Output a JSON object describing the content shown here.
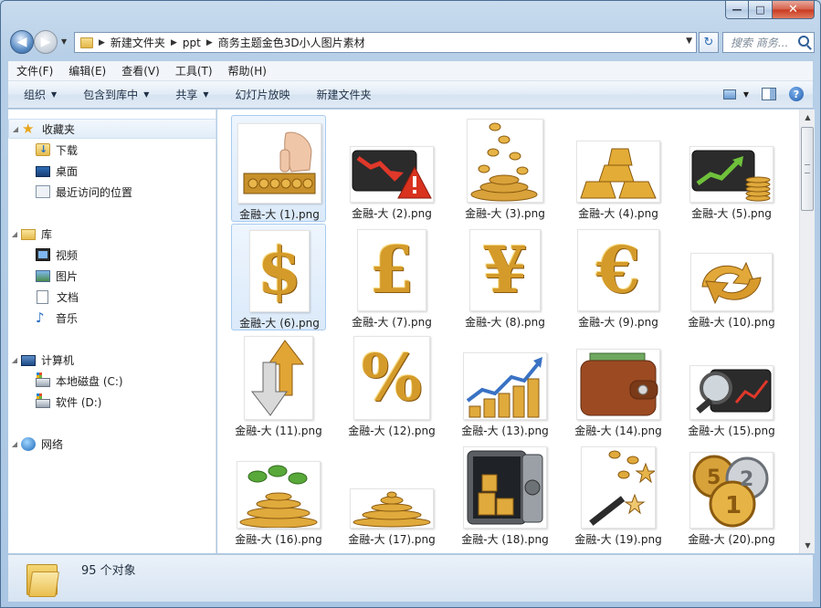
{
  "window": {
    "caption": {
      "minimize": "—",
      "maximize": "□",
      "close": "✕"
    }
  },
  "address": {
    "crumbs": [
      "新建文件夹",
      "ppt",
      "商务主题金色3D小人图片素材"
    ],
    "search_placeholder": "搜索 商务...",
    "back_glyph": "◀",
    "forward_glyph": "▶",
    "refresh_glyph": "↻"
  },
  "menubar": [
    "文件(F)",
    "编辑(E)",
    "查看(V)",
    "工具(T)",
    "帮助(H)"
  ],
  "commandbar": {
    "organize": "组织",
    "include_in_library": "包含到库中",
    "share": "共享",
    "slideshow": "幻灯片放映",
    "new_folder": "新建文件夹",
    "help_glyph": "?"
  },
  "navpane": {
    "favorites": "收藏夹",
    "downloads": "下载",
    "desktop": "桌面",
    "recent": "最近访问的位置",
    "libraries": "库",
    "videos": "视频",
    "pictures": "图片",
    "documents": "文档",
    "music": "音乐",
    "computer": "计算机",
    "drive_c": "本地磁盘 (C:)",
    "drive_d": "软件 (D:)",
    "network": "网络"
  },
  "files": [
    {
      "name": "金融-大 (1).png",
      "icon": "abacus-icon"
    },
    {
      "name": "金融-大 (2).png",
      "icon": "falling-chart-warning-icon"
    },
    {
      "name": "金融-大 (3).png",
      "icon": "falling-coins-icon"
    },
    {
      "name": "金融-大 (4).png",
      "icon": "gold-bars-icon"
    },
    {
      "name": "金融-大 (5).png",
      "icon": "rising-chart-coins-icon"
    },
    {
      "name": "金融-大 (6).png",
      "icon": "dollar-sign-icon",
      "symbol": "$"
    },
    {
      "name": "金融-大 (7).png",
      "icon": "pound-sign-icon",
      "symbol": "£"
    },
    {
      "name": "金融-大 (8).png",
      "icon": "yen-sign-icon",
      "symbol": "¥"
    },
    {
      "name": "金融-大 (9).png",
      "icon": "euro-sign-icon",
      "symbol": "€"
    },
    {
      "name": "金融-大 (10).png",
      "icon": "exchange-arrows-icon"
    },
    {
      "name": "金融-大 (11).png",
      "icon": "up-down-arrows-icon"
    },
    {
      "name": "金融-大 (12).png",
      "icon": "percent-sign-icon",
      "symbol": "%"
    },
    {
      "name": "金融-大 (13).png",
      "icon": "growth-coins-chart-icon"
    },
    {
      "name": "金融-大 (14).png",
      "icon": "wallet-icon"
    },
    {
      "name": "金融-大 (15).png",
      "icon": "magnifier-chart-icon"
    },
    {
      "name": "金融-大 (16).png",
      "icon": "money-plant-icon"
    },
    {
      "name": "金融-大 (17).png",
      "icon": "coin-pile-icon"
    },
    {
      "name": "金融-大 (18).png",
      "icon": "safe-icon"
    },
    {
      "name": "金融-大 (19).png",
      "icon": "magic-wand-coins-icon"
    },
    {
      "name": "金融-大 (20).png",
      "icon": "numbered-coins-icon"
    }
  ],
  "status": {
    "count_text": "95 个对象"
  },
  "colors": {
    "chrome": "#b7cfe7",
    "selection": "#dbeafa",
    "gold": "#d49b2a"
  }
}
